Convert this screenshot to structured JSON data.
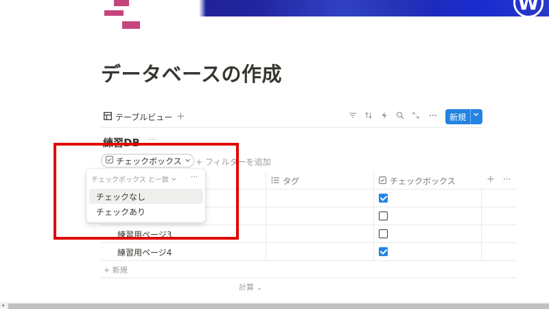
{
  "cover": {
    "logo_glyph": "W"
  },
  "page": {
    "title": "データベースの作成"
  },
  "view_bar": {
    "tab_icon": "table-icon",
    "tab_label": "テーブルビュー",
    "add_view": "+",
    "tools": [
      "filter-icon",
      "sort-icon",
      "lightning-icon",
      "search-icon",
      "expand-icon",
      "more-icon"
    ],
    "new_label": "新規"
  },
  "database": {
    "title": "練習DB",
    "more": "···",
    "filter_chip": "チェックボックス",
    "add_filter": "+ フィルターを追加"
  },
  "table": {
    "columns": [
      {
        "icon": "list-icon",
        "label": "タグ"
      },
      {
        "icon": "checkbox-icon",
        "label": "チェックボックス"
      }
    ],
    "add_column": "+",
    "more": "···",
    "rows": [
      {
        "name": "",
        "checked": true
      },
      {
        "name": "",
        "checked": false
      },
      {
        "name": "練習用ページ3",
        "checked": false
      },
      {
        "name": "練習用ページ4",
        "checked": true
      }
    ],
    "new_row": "+ 新規",
    "calculate": "計算 ⌄"
  },
  "dropdown": {
    "header": "チェックボックス と一致",
    "more": "···",
    "options": [
      "チェックなし",
      "チェックあり"
    ]
  },
  "colors": {
    "accent": "#2383e2",
    "highlight": "#e00000",
    "icon_pink": "#c4447e",
    "cover_blue": "#1f2ba8"
  }
}
